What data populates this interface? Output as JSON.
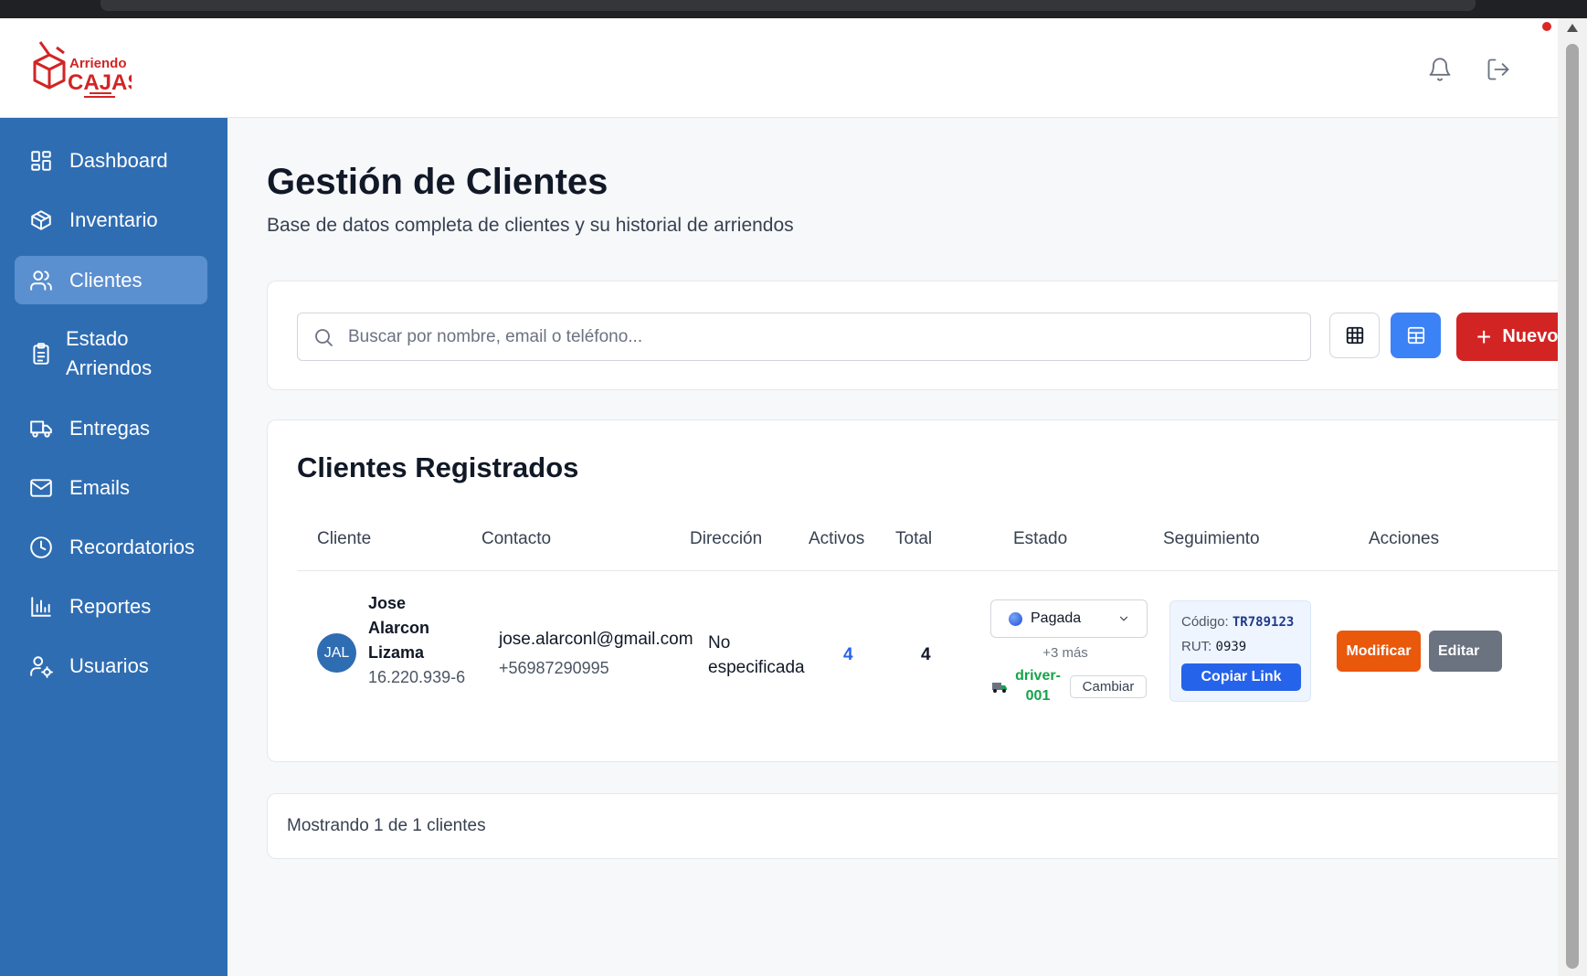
{
  "app": {
    "logo_alt": "Arriendo Cajas",
    "logo_text_top": "Arriendo",
    "logo_text_bottom": "CAJAS"
  },
  "header": {
    "icons": [
      "bell-icon",
      "logout-icon"
    ],
    "brand_color": "#d32424"
  },
  "sidebar": {
    "background": "#2f6db3",
    "items": [
      {
        "label": "Dashboard",
        "icon": "dashboard-icon"
      },
      {
        "label": "Inventario",
        "icon": "box-icon"
      },
      {
        "label": "Clientes",
        "icon": "users-icon",
        "active": true
      },
      {
        "label": "Estado Arriendos",
        "icon": "clipboard-icon"
      },
      {
        "label": "Entregas",
        "icon": "truck-icon"
      },
      {
        "label": "Emails",
        "icon": "mail-icon"
      },
      {
        "label": "Recordatorios",
        "icon": "clock-icon"
      },
      {
        "label": "Reportes",
        "icon": "chart-icon"
      },
      {
        "label": "Usuarios",
        "icon": "user-settings-icon"
      }
    ]
  },
  "main": {
    "title": "Gestión de Clientes",
    "subtitle": "Base de datos completa de clientes y su historial de arriendos",
    "search": {
      "placeholder": "Buscar por nombre, email o teléfono...",
      "value": ""
    },
    "view_toggle": {
      "active": "table"
    },
    "new_button_label": "Nuevo"
  },
  "table": {
    "title": "Clientes Registrados",
    "columns": [
      "Cliente",
      "Contacto",
      "Dirección",
      "Activos",
      "Total",
      "Estado",
      "Seguimiento",
      "Acciones"
    ],
    "rows": [
      {
        "initials": "JAL",
        "name": "Jose Alarcon Lizama",
        "rut": "16.220.939-6",
        "email": "jose.alarconl@gmail.com",
        "phone": "+56987290995",
        "address": "No especificada",
        "activos": "4",
        "total": "4",
        "estado": "Pagada",
        "estado_more": "+3 más",
        "driver": "driver-001",
        "cambiar_label": "Cambiar",
        "tracking_code_label": "Código:",
        "tracking_code": "TR789123",
        "tracking_rut_label": "RUT:",
        "tracking_rut": "0939",
        "copy_link_label": "Copiar Link",
        "modificar_label": "Modificar",
        "editar_label": "Editar"
      }
    ]
  },
  "footer": {
    "summary": "Mostrando 1 de 1 clientes"
  }
}
